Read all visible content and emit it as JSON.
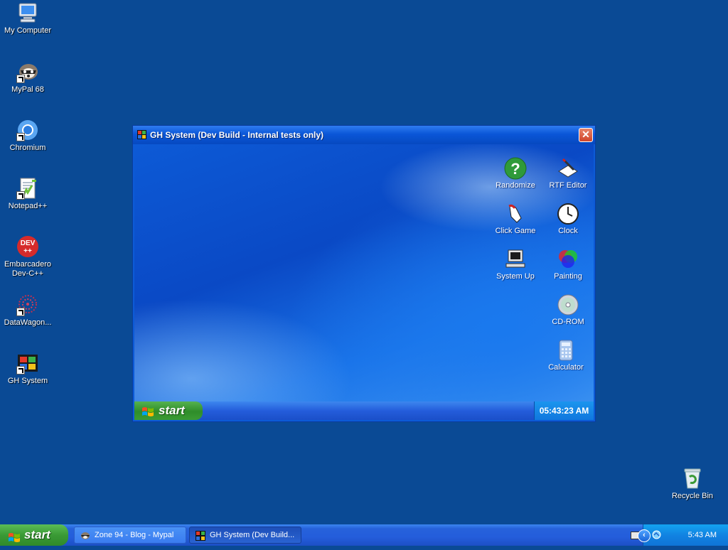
{
  "desktop": {
    "icons": [
      {
        "label": "My Computer",
        "icon": "my-computer-icon"
      },
      {
        "label": "MyPal 68",
        "icon": "mypal-icon"
      },
      {
        "label": "Chromium",
        "icon": "chromium-icon"
      },
      {
        "label": "Notepad++",
        "icon": "notepad-plus-plus-icon"
      },
      {
        "label": "Embarcadero Dev-C++",
        "icon": "dev-cpp-icon",
        "badge": "DEV ++"
      },
      {
        "label": "DataWagon...",
        "icon": "datawagon-icon"
      },
      {
        "label": "GH System",
        "icon": "gh-system-icon"
      },
      {
        "label": "Recycle Bin",
        "icon": "recycle-bin-icon"
      }
    ]
  },
  "window": {
    "title": "GH System (Dev Build - Internal tests only)",
    "close_label": "✕",
    "icons": [
      {
        "label": "Randomize",
        "icon": "question-mark-icon"
      },
      {
        "label": "RTF Editor",
        "icon": "rtf-editor-icon"
      },
      {
        "label": "Click Game",
        "icon": "click-game-icon"
      },
      {
        "label": "Clock",
        "icon": "clock-icon"
      },
      {
        "label": "System Up",
        "icon": "computer-icon"
      },
      {
        "label": "Painting",
        "icon": "painting-icon"
      },
      {
        "label": "CD-ROM",
        "icon": "cdrom-icon"
      },
      {
        "label": "Calculator",
        "icon": "calculator-icon"
      }
    ],
    "taskbar": {
      "start_label": "start",
      "clock": "05:43:23 AM"
    }
  },
  "taskbar": {
    "start_label": "start",
    "buttons": [
      {
        "label": "Zone 94 - Blog - Mypal",
        "icon": "mypal-icon",
        "active": false
      },
      {
        "label": "GH System (Dev Build...",
        "icon": "gh-system-icon",
        "active": true
      }
    ],
    "tray": {
      "collapse_label": "‹",
      "time": "5:43 AM"
    }
  },
  "colors": {
    "desktop_bg": "#0a4a95",
    "titlebar": "#0a56d8",
    "start_green": "#3a9a35",
    "tray_blue": "#1183e2"
  }
}
